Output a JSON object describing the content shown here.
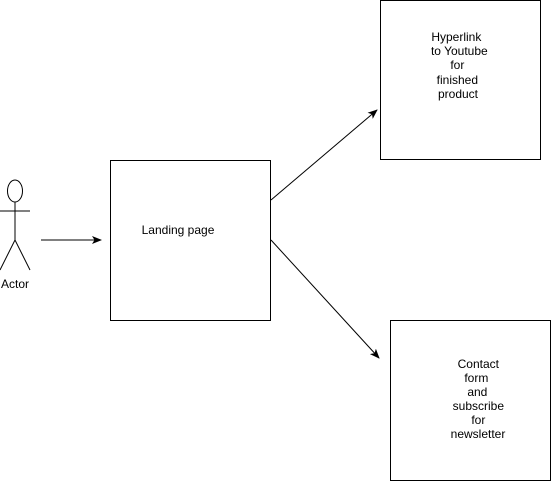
{
  "diagram": {
    "actor": {
      "label": "Actor"
    },
    "nodes": {
      "landing": {
        "lines": [
          "Landing page"
        ]
      },
      "youtube": {
        "lines": [
          "Hyperlink",
          "to Youtube",
          "for",
          "finished",
          "product"
        ]
      },
      "contact": {
        "lines": [
          "Contact",
          "form",
          "and",
          "subscribe",
          "for",
          "newsletter"
        ]
      }
    },
    "colors": {
      "stroke": "#000000",
      "fill": "#ffffff",
      "text": "#000000"
    }
  }
}
